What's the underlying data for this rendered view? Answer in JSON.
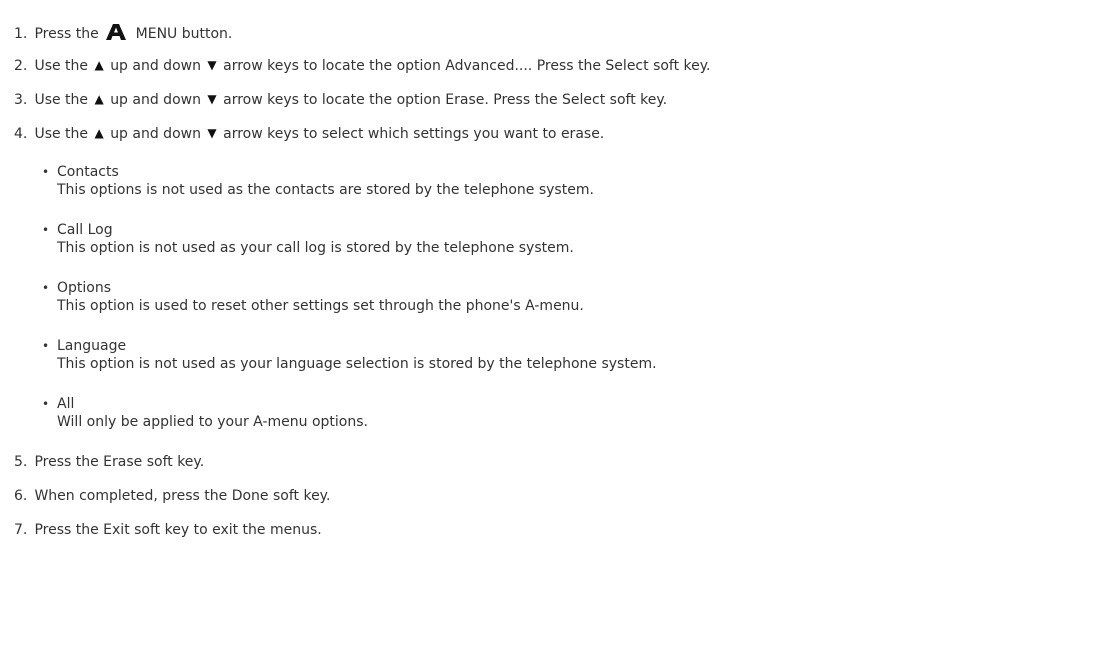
{
  "steps": {
    "s1": {
      "num": "1.",
      "pre": "Press the",
      "post": "MENU button."
    },
    "s2": {
      "num": "2.",
      "pre": "Use the",
      "mid": "up and down",
      "post": "arrow keys to locate the option Advanced.... Press the Select soft key."
    },
    "s3": {
      "num": "3.",
      "pre": "Use the",
      "mid": "up and down",
      "post": "arrow keys to locate the option Erase. Press the Select soft key."
    },
    "s4": {
      "num": "4.",
      "pre": "Use the",
      "mid": "up and down",
      "post": "arrow keys to select which settings you want to erase."
    },
    "s5": {
      "num": "5.",
      "text": "Press the Erase soft key."
    },
    "s6": {
      "num": "6.",
      "text": "When completed, press the Done soft key."
    },
    "s7": {
      "num": "7.",
      "text": "Press the Exit soft key to exit the menus."
    }
  },
  "icons": {
    "menu_button": "a-menu-icon",
    "up_arrow": "▲",
    "down_arrow": "▼",
    "bullet": "•"
  },
  "options": [
    {
      "title": "Contacts",
      "desc": "This options is not used as the contacts are stored by the telephone system."
    },
    {
      "title": "Call Log",
      "desc": "This option is not used as your call log is stored by the telephone system."
    },
    {
      "title": "Options",
      "desc": "This option is used to reset other settings set through the phone's A-menu."
    },
    {
      "title": "Language",
      "desc": "This option is not used as your language selection is stored by the telephone system."
    },
    {
      "title": "All",
      "desc": "Will only be applied to your A-menu options."
    }
  ]
}
